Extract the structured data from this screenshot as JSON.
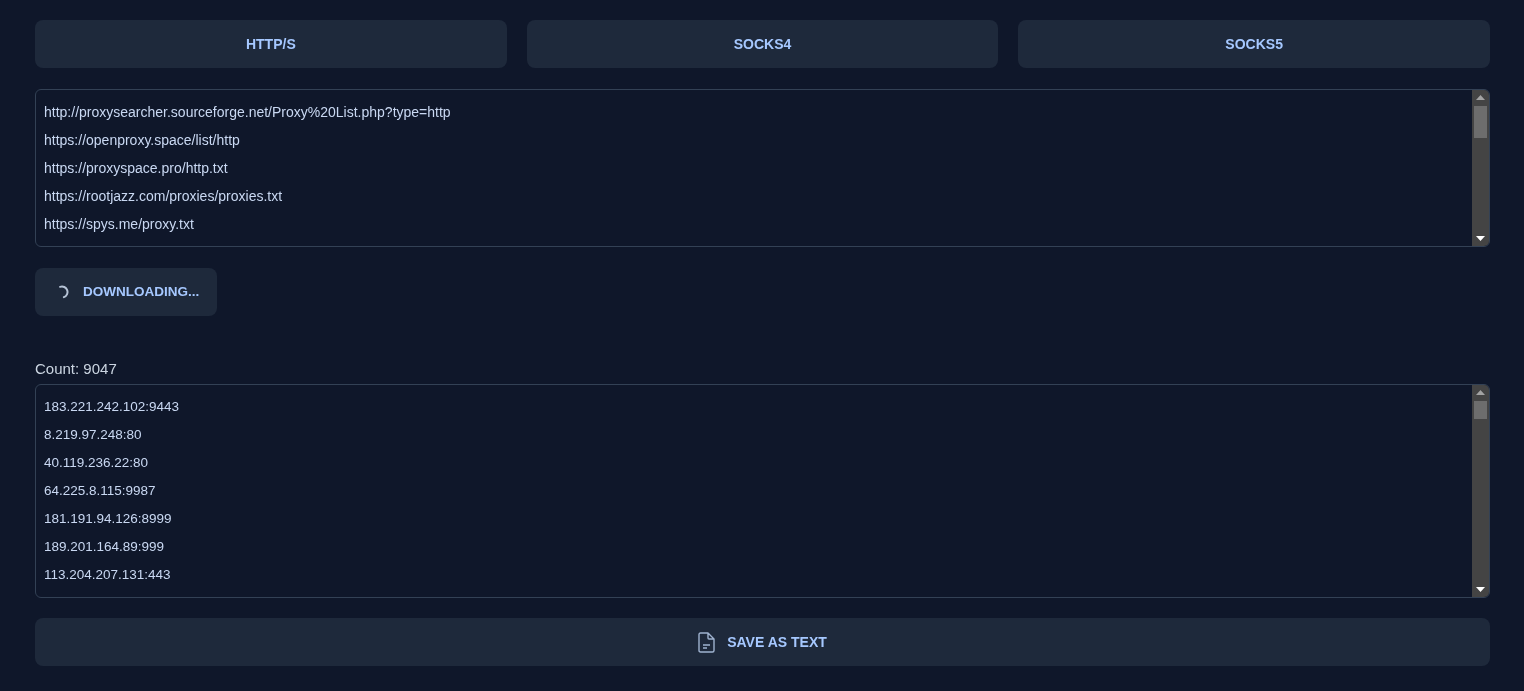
{
  "protocol_buttons": [
    {
      "label": "HTTP/S"
    },
    {
      "label": "SOCKS4"
    },
    {
      "label": "SOCKS5"
    }
  ],
  "sources": {
    "lines": [
      "http://proxysearcher.sourceforge.net/Proxy%20List.php?type=http",
      "https://openproxy.space/list/http",
      "https://proxyspace.pro/http.txt",
      "https://rootjazz.com/proxies/proxies.txt",
      "https://spys.me/proxy.txt"
    ]
  },
  "download_button": {
    "label": "DOWNLOADING...",
    "loading": true
  },
  "count_label": "Count: 9047",
  "proxies": {
    "lines": [
      "183.221.242.102:9443",
      "8.219.97.248:80",
      "40.119.236.22:80",
      "64.225.8.115:9987",
      "181.191.94.126:8999",
      "189.201.164.89:999",
      "113.204.207.131:443"
    ]
  },
  "save_button": {
    "label": "SAVE AS TEXT"
  }
}
